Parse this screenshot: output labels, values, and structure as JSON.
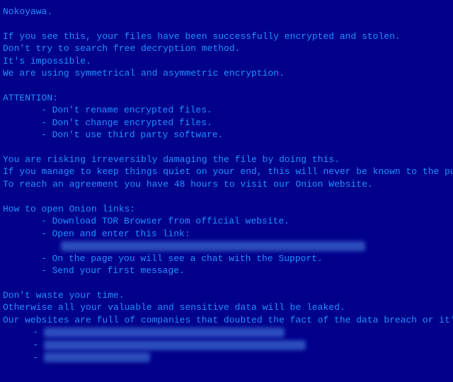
{
  "title": "Nokoyawa.",
  "intro": [
    "If you see this, your files have been successfully encrypted and stolen.",
    "Don't try to search free decryption method.",
    "It's impossible.",
    "We are using symmetrical and asymmetric encryption."
  ],
  "attention": {
    "label": "ATTENTION:",
    "items": [
      "- Don't rename encrypted files.",
      "- Don't change encrypted files.",
      "- Don't use third party software."
    ]
  },
  "warning": [
    "You are risking irreversibly damaging the file by doing this.",
    "If you manage to keep things quiet on your end, this will never be known to the public.",
    "To reach an agreement you have 48 hours to visit our Onion Website."
  ],
  "howto": {
    "label": "How to open Onion links:",
    "items": [
      "- Download TOR Browser from official website.",
      "- Open and enter this link:",
      "- On the page you will see a chat with the Support.",
      "- Send your first message."
    ]
  },
  "closing": [
    "Don't waste your time.",
    "Otherwise all your valuable and sensitive data will be leaked.",
    "Our websites are full of companies that doubted the fact of the data breach or it's extent"
  ],
  "dash": "- "
}
